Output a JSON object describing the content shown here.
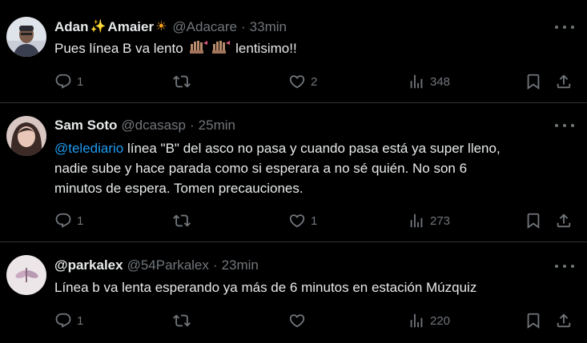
{
  "tweets": [
    {
      "name": "Adan",
      "name_suffix": "Amaier",
      "emoji_sparkles": "✨",
      "emoji_sun": "☀",
      "handle": "@Adacare",
      "separator": "·",
      "time": "33min",
      "text_before": "Pues línea B va lento",
      "text_after": "lentisimo!!",
      "replies": "1",
      "retweets": "",
      "likes": "2",
      "views": "348"
    },
    {
      "name": "Sam Soto",
      "handle": "@dcasasp",
      "separator": "·",
      "time": "25min",
      "mention": "@telediario",
      "text_line1": " línea \"B\" del asco no pasa y cuando pasa está ya super lleno,",
      "text_line2": "nadie sube y hace parada como si esperara a no sé quién. No son 6",
      "text_line3": "minutos de espera. Tomen precauciones.",
      "replies": "1",
      "retweets": "",
      "likes": "1",
      "views": "273"
    },
    {
      "name": "@parkalex",
      "handle": "@54Parkalex",
      "separator": "·",
      "time": "23min",
      "text": "Línea b va lenta esperando ya más de 6 minutos en estación Múzquiz",
      "replies": "1",
      "retweets": "",
      "likes": "",
      "views": "220"
    }
  ],
  "colors": {
    "background": "#000000",
    "text": "#e7e9ea",
    "muted": "#71767b",
    "link": "#1d9bf0",
    "divider": "#2f3336"
  },
  "icons": [
    "reply-icon",
    "retweet-icon",
    "like-icon",
    "views-icon",
    "bookmark-icon",
    "share-icon",
    "more-icon",
    "raised-hand-emoji"
  ]
}
